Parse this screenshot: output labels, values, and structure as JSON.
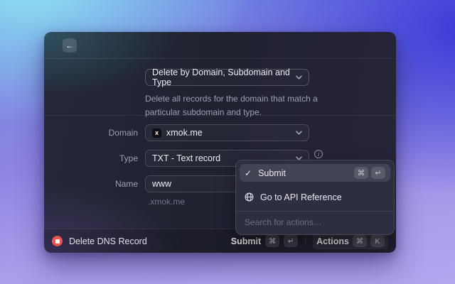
{
  "window": {
    "header": {
      "back_icon": "←"
    },
    "mode_select": {
      "value": "Delete by Domain, Subdomain and Type"
    },
    "description": "Delete all records for the domain that match a particular subdomain and type.",
    "form": {
      "domain": {
        "label": "Domain",
        "value": "xmok.me",
        "tag_initial": "x"
      },
      "type": {
        "label": "Type",
        "value": "TXT - Text record",
        "info_glyph": "i"
      },
      "name": {
        "label": "Name",
        "value": "www",
        "hint": ".xmok.me"
      }
    },
    "action_panel": {
      "items": [
        {
          "label": "Submit",
          "icon_glyph": "✓",
          "keys": [
            "⌘",
            "↵"
          ]
        },
        {
          "label": "Go to API Reference"
        }
      ],
      "search_placeholder": "Search for actions…"
    },
    "bottom_bar": {
      "title": "Delete DNS Record",
      "primary_action": {
        "label": "Submit",
        "keys": [
          "⌘",
          "↵"
        ]
      },
      "actions_button": {
        "label": "Actions",
        "keys": [
          "⌘",
          "K"
        ]
      }
    }
  },
  "colors": {
    "accent_red": "#e8544f",
    "panel_bg": "#2d2e40",
    "desktop_cyan": "#8fe9f4",
    "desktop_indigo": "#3c3bd8",
    "desktop_purple": "#a99ceb"
  }
}
